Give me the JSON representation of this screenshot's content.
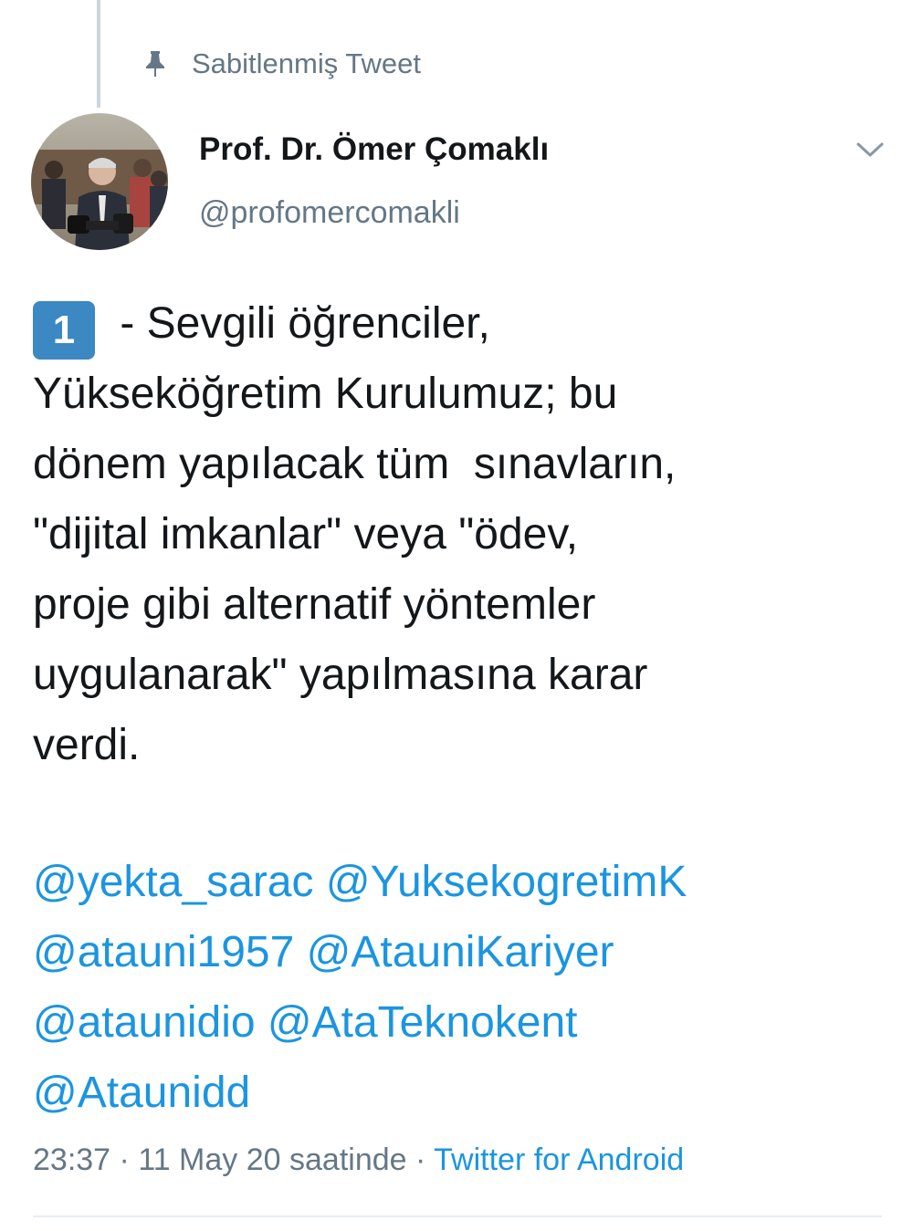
{
  "pinned": {
    "icon": "pin-icon",
    "label": "Sabitlenmiş Tweet"
  },
  "author": {
    "avatar_icon": "avatar-photo",
    "name": "Prof. Dr. Ömer Çomaklı",
    "handle": "@profomercomakli",
    "menu_icon": "chevron-down-icon"
  },
  "tweet": {
    "number_badge": "1",
    "lines": [
      " - Sevgili öğrenciler,",
      "Yükseköğretim Kurulumuz; bu",
      "dönem yapılacak tüm  sınavların,",
      "\"dijital imkanlar\" veya \"ödev,",
      "proje gibi alternatif yöntemler",
      "uygulanarak\" yapılmasına karar",
      "verdi."
    ],
    "mentions": [
      "@yekta_sarac",
      "@YuksekogretimK",
      "@atauni1957",
      "@AtauniKariyer",
      "@ataunidio",
      "@AtaTeknokent",
      "@Ataunidd"
    ]
  },
  "meta": {
    "time": "23:37",
    "separator": " · ",
    "date": "11 May 20 saatinde",
    "source": "Twitter for Android"
  },
  "colors": {
    "link": "#1b95e0",
    "secondary_text": "#657786",
    "badge": "#3b88c3",
    "divider": "#e6ecf0"
  }
}
